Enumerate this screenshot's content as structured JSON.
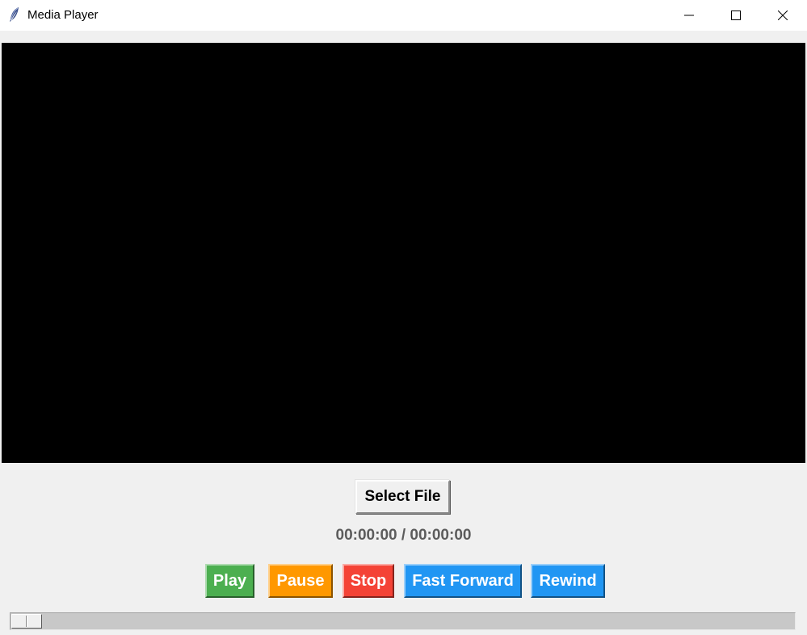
{
  "window": {
    "title": "Media Player",
    "controls": [
      "minimize",
      "maximize",
      "close"
    ]
  },
  "icons": {
    "app": "feather-icon",
    "minimize": "minimize-icon",
    "maximize": "maximize-icon",
    "close": "close-icon"
  },
  "file": {
    "select_label": "Select File"
  },
  "time": {
    "display": "00:00:00 / 00:00:00"
  },
  "controls": {
    "play": {
      "label": "Play",
      "color": "#4caf50"
    },
    "pause": {
      "label": "Pause",
      "color": "#ff9800"
    },
    "stop": {
      "label": "Stop",
      "color": "#f44336"
    },
    "fast_forward": {
      "label": "Fast Forward",
      "color": "#2196f3"
    },
    "rewind": {
      "label": "Rewind",
      "color": "#2196f3"
    }
  },
  "video": {
    "background": "#000000"
  },
  "seek": {
    "position_fraction": 0
  }
}
